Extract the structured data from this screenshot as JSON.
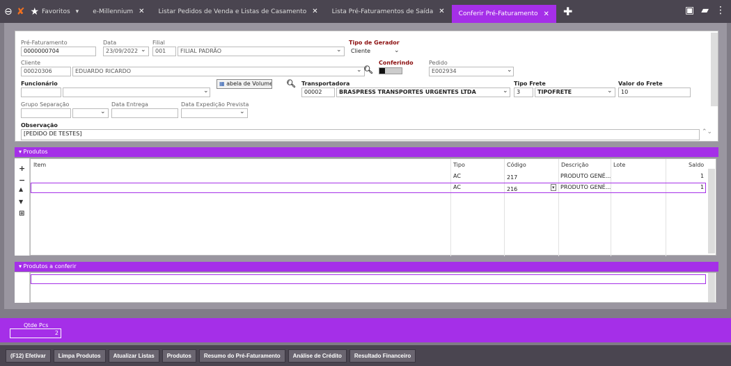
{
  "tabs": [
    {
      "label": "Favoritos",
      "suffix": "▾"
    },
    {
      "label": "e-Millennium"
    },
    {
      "label": "Listar Pedidos de Venda e Listas de Casamento"
    },
    {
      "label": "Lista Pré-Faturamentos de Saída"
    },
    {
      "label": "Conferir Pré-Faturamento",
      "active": true
    }
  ],
  "form": {
    "pre_faturamento_label": "Pré-Faturamento",
    "pre_faturamento": "0000000704",
    "data_label": "Data",
    "data": "23/09/2022",
    "filial_label": "Filial",
    "filial_code": "001",
    "filial_name": "FILIAL PADRÃO",
    "tipo_gerador_label": "Tipo de Gerador",
    "tipo_gerador": "Cliente",
    "cliente_label": "Cliente",
    "cliente_code": "00020306",
    "cliente_name": "EDUARDO RICARDO",
    "conferindo_label": "Conferindo",
    "pedido_label": "Pedido",
    "pedido": "E002934",
    "funcionario_label": "Funcionário",
    "tabela_volume": "abela de Volume",
    "transportadora_label": "Transportadora",
    "transportadora_code": "00002",
    "transportadora_name": "BRASPRESS TRANSPORTES URGENTES LTDA",
    "tipo_frete_label": "Tipo Frete",
    "tipo_frete_code": "3",
    "tipo_frete_name": "TIPOFRETE",
    "valor_frete_label": "Valor do Frete",
    "valor_frete": "10",
    "grupo_label": "Grupo Separação",
    "data_entrega_label": "Data Entrega",
    "data_expedicao_label": "Data Expedição Prevista",
    "observacao_label": "Observação",
    "observacao": "[PEDIDO DE TESTES]"
  },
  "produtos": {
    "title": "▾ Produtos",
    "headers": {
      "item": "Item",
      "tipo": "Tipo",
      "codigo": "Código",
      "descricao": "Descrição",
      "lote": "Lote",
      "saldo": "Saldo"
    },
    "rows": [
      {
        "tipo": "AC",
        "codigo": "217",
        "descricao": "PRODUTO GENÉ...",
        "saldo": "1"
      },
      {
        "tipo": "AC",
        "codigo": "216",
        "descricao": "PRODUTO GENÉ...",
        "saldo": "1"
      }
    ]
  },
  "conferir": {
    "title": "▾ Produtos a conferir"
  },
  "footer": {
    "qtde_label": "Qtde Pcs",
    "qtde": "2"
  },
  "buttons": [
    "(F12) Efetivar",
    "Limpa Produtos",
    "Atualizar Listas",
    "Produtos",
    "Resumo do Pré-Faturamento",
    "Análise de Crédito",
    "Resultado Financeiro"
  ]
}
